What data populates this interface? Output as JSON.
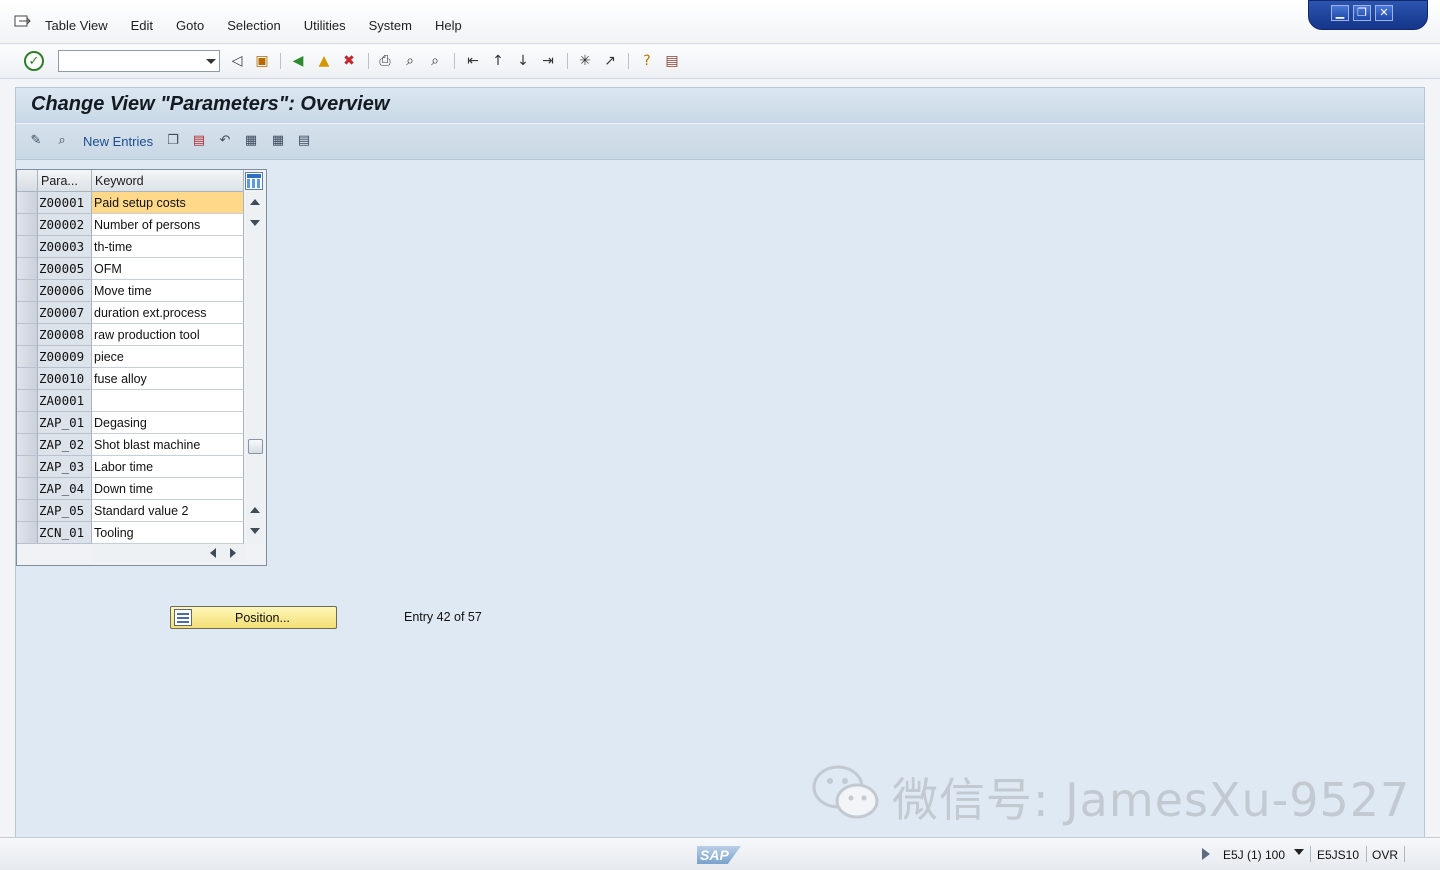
{
  "menu": {
    "items": [
      "Table View",
      "Edit",
      "Goto",
      "Selection",
      "Utilities",
      "System",
      "Help"
    ],
    "mnemonics": [
      "T",
      "E",
      "G",
      "S",
      "U",
      "y",
      "H"
    ]
  },
  "window_controls": [
    "minimize-icon",
    "restore-icon",
    "close-icon"
  ],
  "toolbar": {
    "command_field_value": "",
    "icons": [
      "enter-icon",
      "back-icon",
      "save-icon",
      "back-green-icon",
      "exit-icon",
      "cancel-icon",
      "print-icon",
      "find-icon",
      "find-next-icon",
      "first-page-icon",
      "previous-page-icon",
      "next-page-icon",
      "last-page-icon",
      "create-session-icon",
      "shortcut-icon",
      "help-icon",
      "layout-menu-icon"
    ]
  },
  "title": "Change View \"Parameters\": Overview",
  "app_toolbar": {
    "new_entries_label": "New Entries",
    "icons": [
      "display-change-icon",
      "details-icon",
      "copy-as-icon",
      "delete-icon",
      "undo-change-icon",
      "select-all-icon",
      "select-block-icon",
      "deselect-all-icon"
    ]
  },
  "table": {
    "columns": [
      "Para...",
      "Keyword"
    ],
    "rows": [
      {
        "param": "Z00001",
        "keyword": "Paid setup costs",
        "active": true
      },
      {
        "param": "Z00002",
        "keyword": "Number of persons"
      },
      {
        "param": "Z00003",
        "keyword": "th-time"
      },
      {
        "param": "Z00005",
        "keyword": "OFM"
      },
      {
        "param": "Z00006",
        "keyword": "Move time"
      },
      {
        "param": "Z00007",
        "keyword": "duration ext.process"
      },
      {
        "param": "Z00008",
        "keyword": "raw production tool"
      },
      {
        "param": "Z00009",
        "keyword": "piece"
      },
      {
        "param": "Z00010",
        "keyword": "fuse alloy"
      },
      {
        "param": "ZA0001",
        "keyword": ""
      },
      {
        "param": "ZAP_01",
        "keyword": "Degasing"
      },
      {
        "param": "ZAP_02",
        "keyword": "Shot blast machine"
      },
      {
        "param": "ZAP_03",
        "keyword": "Labor time"
      },
      {
        "param": "ZAP_04",
        "keyword": "Down time"
      },
      {
        "param": "ZAP_05",
        "keyword": "Standard value 2"
      },
      {
        "param": "ZCN_01",
        "keyword": "Tooling"
      }
    ]
  },
  "position_button_label": "Position...",
  "entry_info": "Entry 42 of 57",
  "watermark": "微信号: JamesXu-9527",
  "status": {
    "logo": "SAP",
    "system": "E5J (1) 100",
    "server": "E5JS10",
    "mode": "OVR"
  }
}
